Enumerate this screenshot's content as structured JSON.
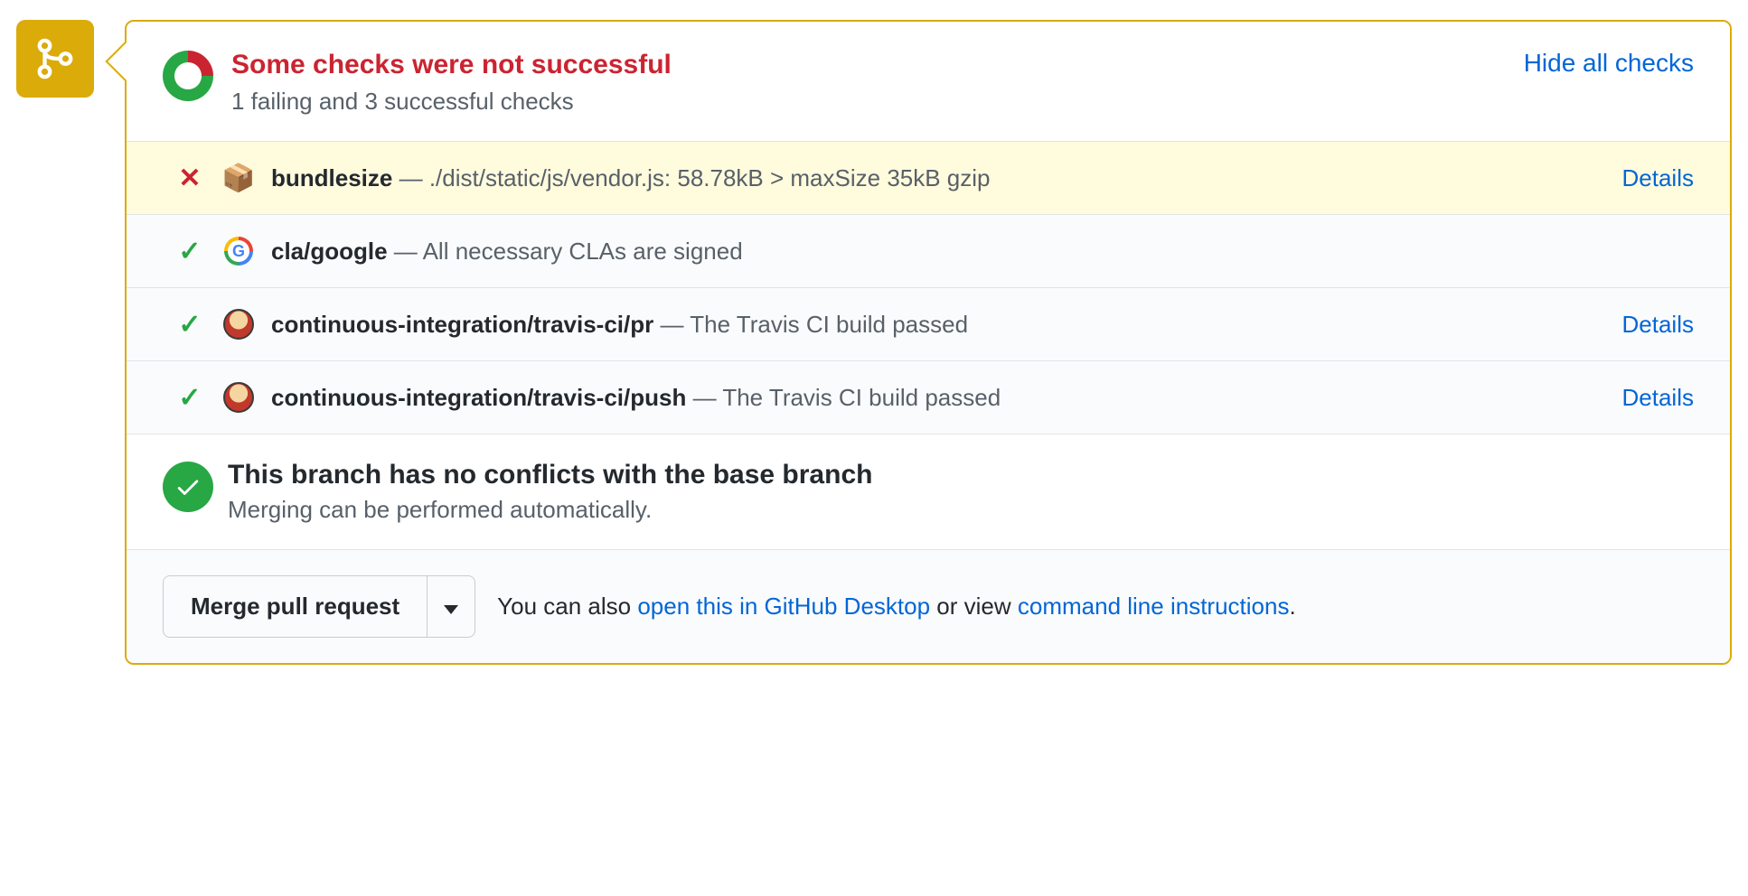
{
  "header": {
    "title": "Some checks were not successful",
    "subtitle": "1 failing and 3 successful checks",
    "hide_link": "Hide all checks"
  },
  "checks": [
    {
      "status": "fail",
      "icon": "package",
      "name": "bundlesize",
      "desc": "./dist/static/js/vendor.js: 58.78kB > maxSize 35kB gzip",
      "details_label": "Details",
      "has_details": true
    },
    {
      "status": "pass",
      "icon": "google",
      "name": "cla/google",
      "desc": "All necessary CLAs are signed",
      "has_details": false
    },
    {
      "status": "pass",
      "icon": "travis",
      "name": "continuous-integration/travis-ci/pr",
      "desc": "The Travis CI build passed",
      "details_label": "Details",
      "has_details": true
    },
    {
      "status": "pass",
      "icon": "travis",
      "name": "continuous-integration/travis-ci/push",
      "desc": "The Travis CI build passed",
      "details_label": "Details",
      "has_details": true
    }
  ],
  "conflicts": {
    "title": "This branch has no conflicts with the base branch",
    "subtitle": "Merging can be performed automatically."
  },
  "footer": {
    "merge_button": "Merge pull request",
    "text_prefix": "You can also ",
    "desktop_link": "open this in GitHub Desktop",
    "text_mid": " or view ",
    "cli_link": "command line instructions",
    "text_suffix": "."
  }
}
